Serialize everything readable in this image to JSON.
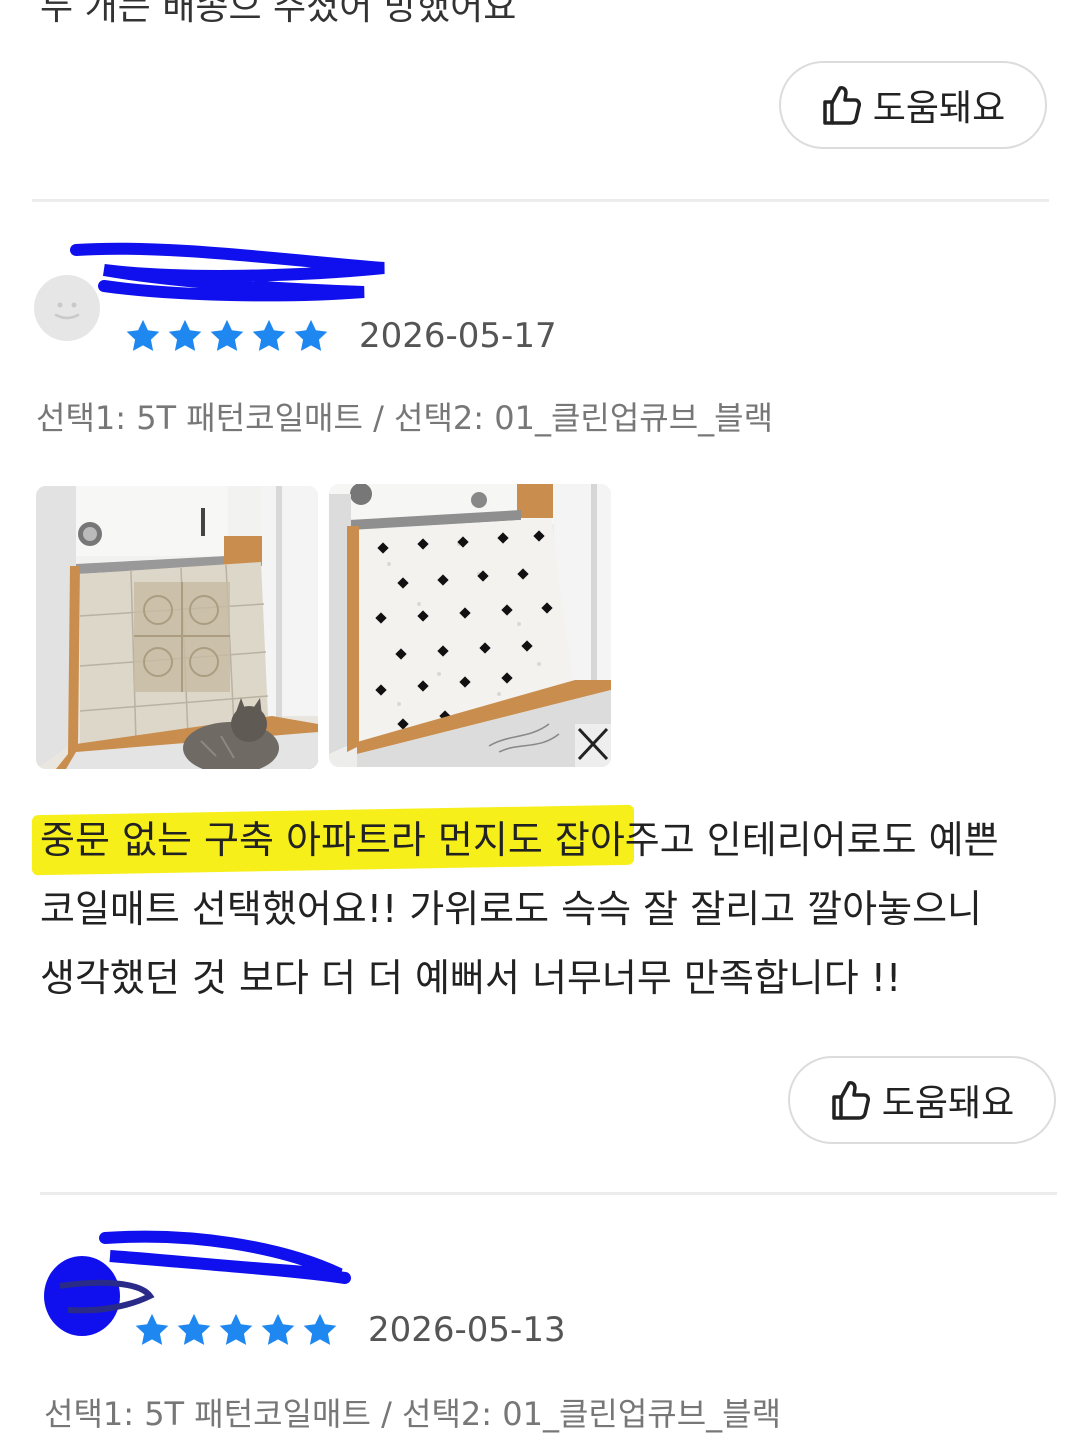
{
  "top": {
    "cut_text": "두 개는 배송으 주셨어 망했어요"
  },
  "reviews": [
    {
      "helpful_label_prev": "도움돼요"
    }
  ],
  "review1": {
    "rating": 5,
    "date": "2026-05-17",
    "options": "선택1: 5T 패턴코일매트 / 선택2: 01_클린업큐브_블랙",
    "photos": [
      "before-photo",
      "after-photo"
    ],
    "text_lines": [
      "중문 없는 구축 아파트라 먼지도 잡아주고 인테리어로도 예쁜",
      "코일매트 선택했어요!! 가위로도 슥슥 잘 잘리고 깔아놓으니",
      "생각했던 것 보다 더 더 예뻐서 너무너무 만족합니다 !!"
    ],
    "highlighted_text": "중문 없는 구축 아파트라 먼지도 잡아",
    "helpful_label": "도움돼요"
  },
  "review2": {
    "rating": 5,
    "date": "2026-05-13",
    "options": "선택1: 5T 패턴코일매트 / 선택2: 01_클린업큐브_블랙"
  },
  "colors": {
    "star": "#1e88f0",
    "highlight": "#f7ef1a",
    "redaction": "#1010ee"
  }
}
